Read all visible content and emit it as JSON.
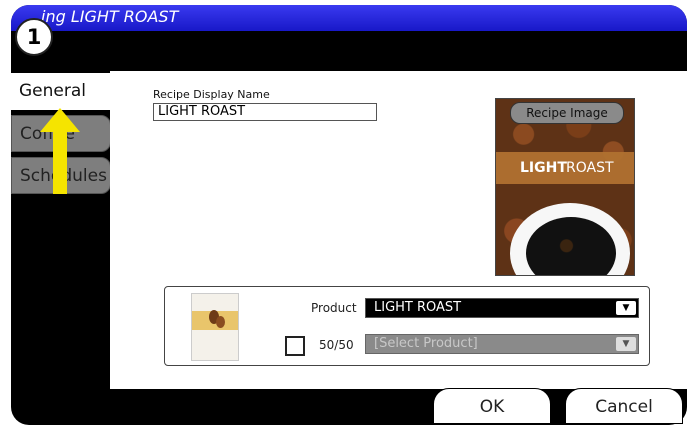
{
  "window": {
    "title": "ing LIGHT ROAST"
  },
  "step_badge": "1",
  "tabs": [
    {
      "label": "General"
    },
    {
      "label": "Coffee"
    },
    {
      "label": "Schedules"
    }
  ],
  "general": {
    "field_label": "Recipe Display Name",
    "field_value": "LIGHT ROAST",
    "image_button": "Recipe Image",
    "image_caption_bold": "LIGHT",
    "image_caption_rest": "ROAST"
  },
  "product": {
    "product_label": "Product",
    "product_value": "LIGHT ROAST",
    "half_label": "50/50",
    "half_placeholder": "[Select Product]"
  },
  "buttons": {
    "ok": "OK",
    "cancel": "Cancel"
  },
  "colors": {
    "title_bar": "#2222e0",
    "arrow": "#f5e400",
    "tab_inactive": "#7e7e7e"
  }
}
